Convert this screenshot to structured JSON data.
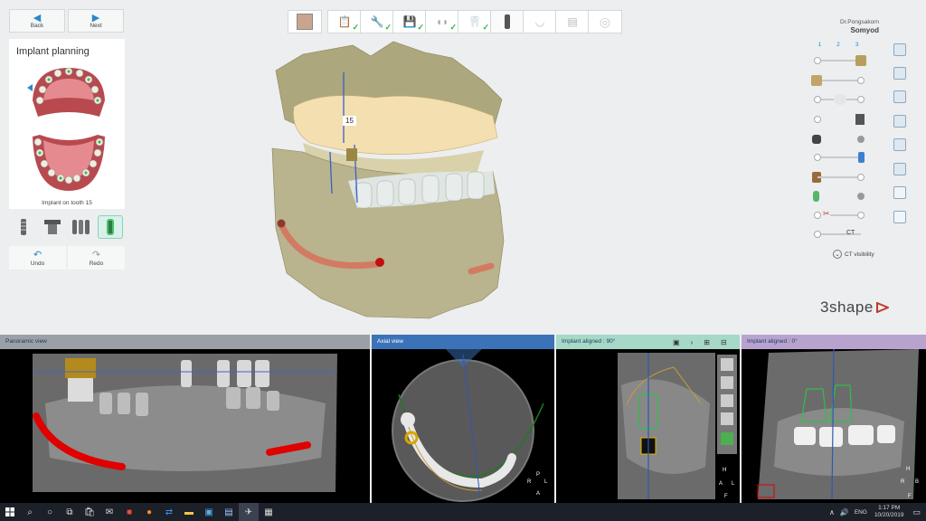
{
  "nav": {
    "back_label": "Back",
    "next_label": "Next"
  },
  "panel": {
    "title": "Implant planning",
    "caption": "Implant on tooth 15"
  },
  "actions": {
    "undo_label": "Undo",
    "redo_label": "Redo"
  },
  "user": {
    "line1": "Dr.Pongsakorn",
    "line2": "Somyod"
  },
  "layers": {
    "cols": [
      "1",
      "2",
      "3"
    ],
    "ct_label": "CT",
    "ct_visibility": "CT visibility"
  },
  "model": {
    "tooth_tag": "15"
  },
  "brand": {
    "name": "3shape"
  },
  "views": {
    "panoramic": "Panoramic view",
    "axial": "Axial view",
    "aligned90": "Implant aligned : 90°",
    "aligned0": "Implant aligned : 0°"
  },
  "orient": {
    "p": "P",
    "r": "R",
    "l": "L",
    "a": "A",
    "h": "H",
    "f": "F",
    "b": "B"
  },
  "taskbar": {
    "lang": "ENG",
    "time": "1:17 PM",
    "date": "10/20/2019"
  },
  "colors": {
    "accent": "#2a8ac8",
    "check": "#2fb34a",
    "panoramic_hdr": "#9aa0a6",
    "axial_hdr": "#3b73b9",
    "aligned90_hdr": "#a6d9c7",
    "aligned0_hdr": "#b8a3cf"
  }
}
